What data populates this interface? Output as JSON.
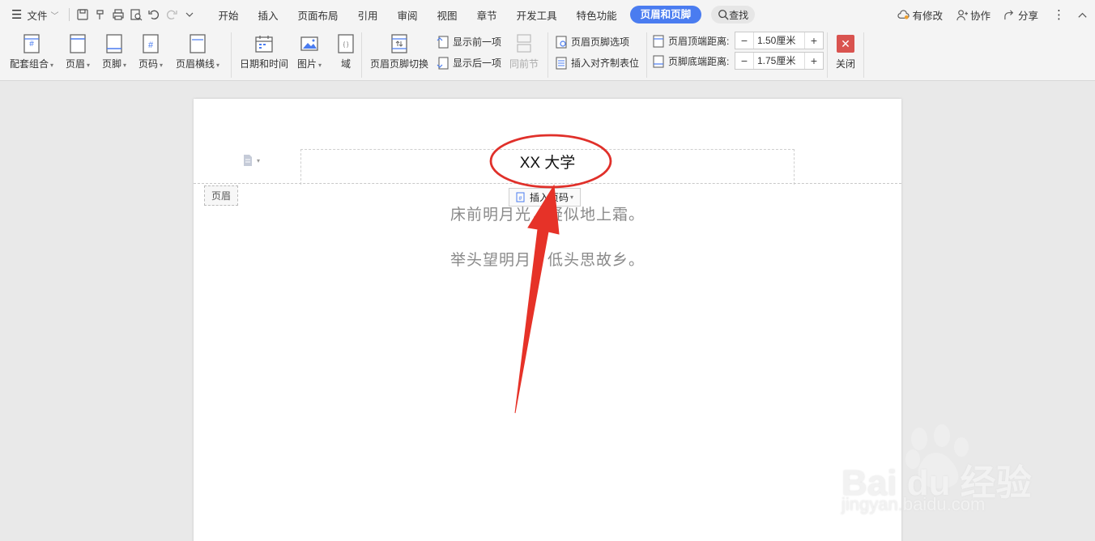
{
  "menubar": {
    "file_label": "文件",
    "tabs": [
      "开始",
      "插入",
      "页面布局",
      "引用",
      "审阅",
      "视图",
      "章节",
      "开发工具",
      "特色功能"
    ],
    "active_tab": "页眉和页脚",
    "search_label": "查找",
    "right": {
      "modified": "有修改",
      "collab": "协作",
      "share": "分享"
    }
  },
  "ribbon": {
    "combo": "配套组合",
    "header": "页眉",
    "footer": "页脚",
    "page_number": "页码",
    "header_line": "页眉横线",
    "datetime": "日期和时间",
    "picture": "图片",
    "field": "域",
    "switch": "页眉页脚切换",
    "show_prev": "显示前一项",
    "show_next": "显示后一项",
    "same_as_prev": "同前节",
    "options": "页眉页脚选项",
    "align_tab": "插入对齐制表位",
    "header_top_label": "页眉顶端距离:",
    "header_top_value": "1.50厘米",
    "footer_bottom_label": "页脚底端距离:",
    "footer_bottom_value": "1.75厘米",
    "close": "关闭"
  },
  "document": {
    "header_text": "XX 大学",
    "header_tag": "页眉",
    "insert_page_number": "插入页码",
    "lines": [
      "床前明月光，疑似地上霜。",
      "举头望明月，低头思故乡。"
    ]
  },
  "watermark": {
    "brand": "Bai du 经验",
    "url": "jingyan.baidu.com"
  },
  "colors": {
    "accent": "#4a7cf0",
    "annotation": "#e0302a",
    "close": "#d9534f"
  }
}
